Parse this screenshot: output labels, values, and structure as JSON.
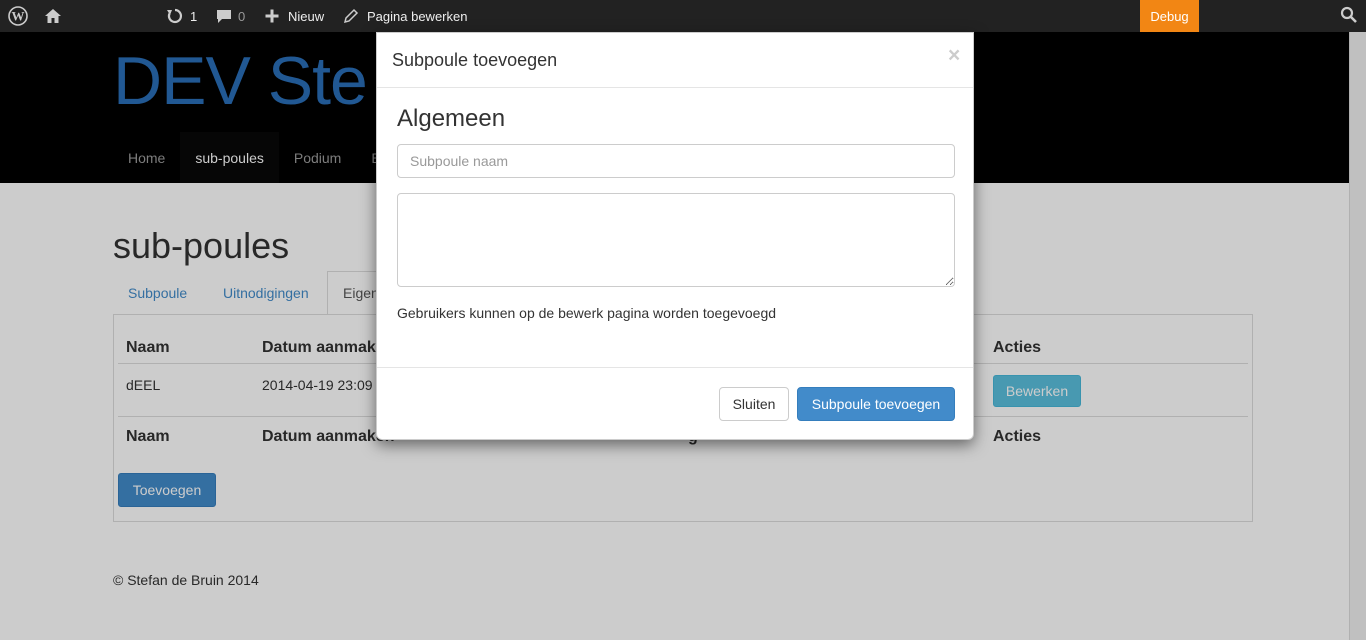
{
  "adminbar": {
    "updates_count": "1",
    "comments_count": "0",
    "new_label": "Nieuw",
    "edit_page_label": "Pagina bewerken",
    "debug_label": "Debug",
    "debug_color": "#f28614"
  },
  "site": {
    "title": "DEV Ste",
    "title_color": "#2a6fb8",
    "nav": [
      {
        "label": "Home"
      },
      {
        "label": "sub-poules"
      },
      {
        "label": "Podium"
      },
      {
        "label": "B"
      }
    ]
  },
  "page": {
    "title": "sub-poules",
    "tabs": [
      {
        "label": "Subpoule"
      },
      {
        "label": "Uitnodigingen"
      },
      {
        "label": "Eigen"
      }
    ],
    "table": {
      "headers": {
        "naam": "Naam",
        "datum": "Datum aanmaken",
        "acties": "Acties"
      },
      "rows": [
        {
          "naam": "dEEL",
          "datum": "2014-04-19 23:09",
          "action_label": "Bewerken"
        }
      ],
      "footer_fragment": "g"
    },
    "add_button_label": "Toevoegen",
    "footer_text": "© Stefan de Bruin 2014"
  },
  "modal": {
    "title": "Subpoule toevoegen",
    "close_symbol": "×",
    "section_title": "Algemeen",
    "name_placeholder": "Subpoule naam",
    "description_value": "",
    "help_text": "Gebruikers kunnen op de bewerk pagina worden toegevoegd",
    "close_button_label": "Sluiten",
    "submit_button_label": "Subpoule toevoegen",
    "accent_color": "#428bca"
  }
}
